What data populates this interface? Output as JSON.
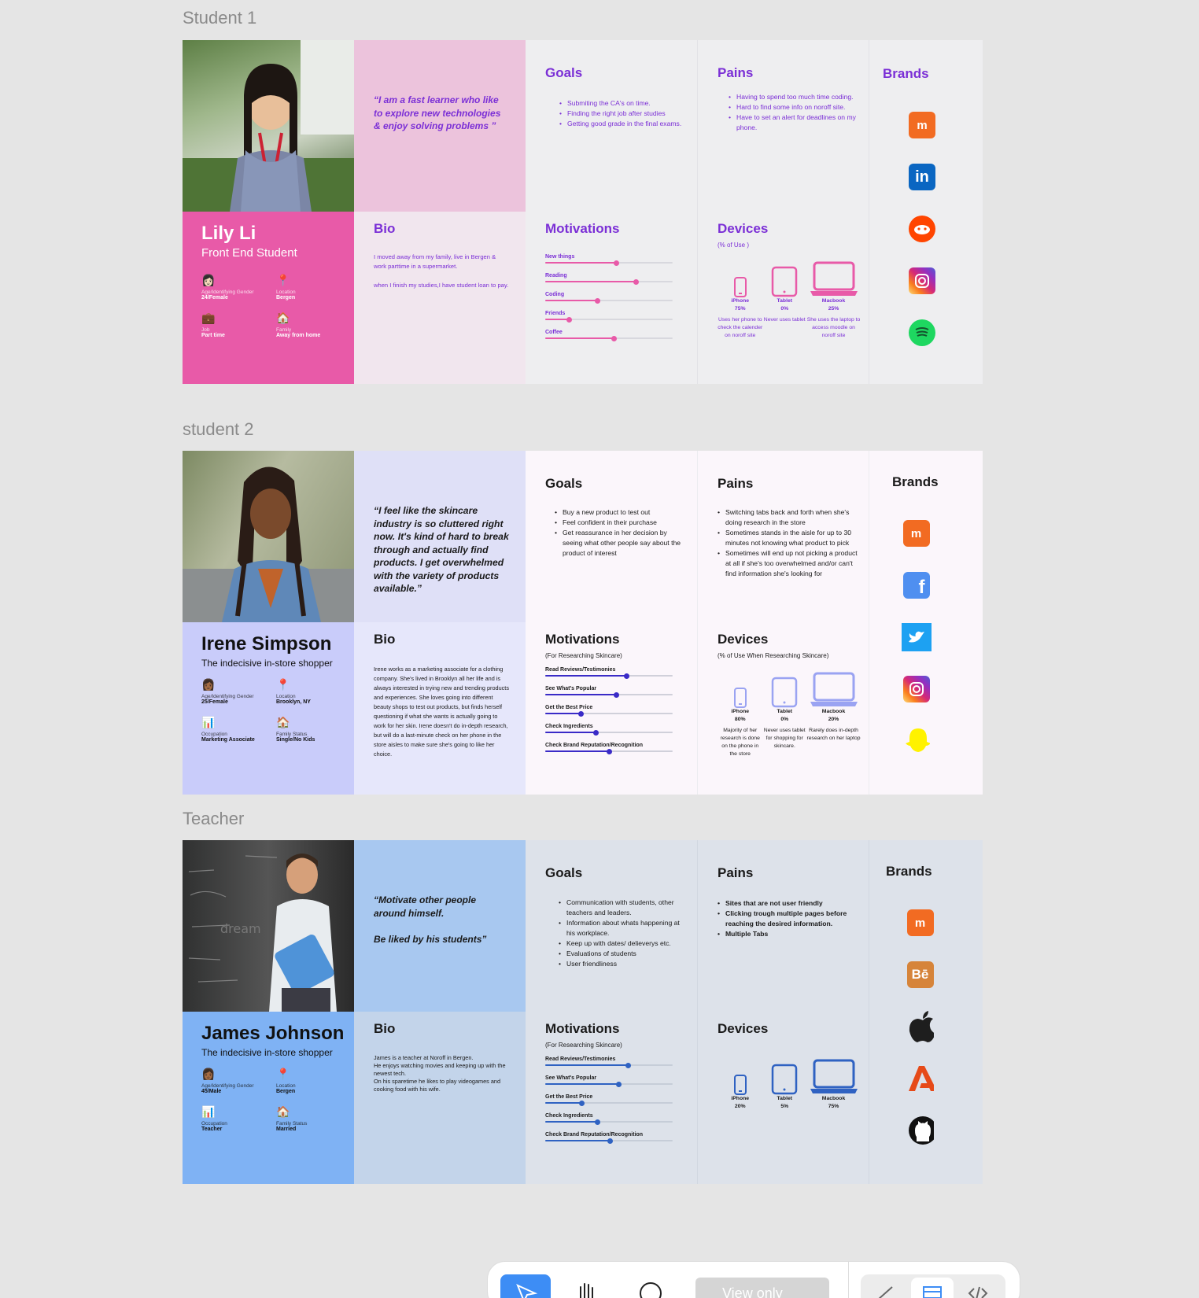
{
  "frames": {
    "student1": "Student 1",
    "student2": "student 2",
    "teacher": "Teacher"
  },
  "p1": {
    "quote": "“I am a fast learner who like to explore new technologies & enjoy solving problems ”",
    "goals_title": "Goals",
    "goals": [
      "Submiting the CA's on time.",
      "Finding the right job after studies",
      "Getting good grade in the final exams."
    ],
    "pains_title": "Pains",
    "pains": [
      "Having to spend too much time coding.",
      "Hard to find some info on noroff site.",
      "Have to set an alert for deadlines on my phone."
    ],
    "name": "Lily Li",
    "role": "Front End Student",
    "facts": [
      {
        "icon": "👩🏻",
        "label": "Age/Identifying Gender",
        "value": "24/Female"
      },
      {
        "icon": "📍",
        "label": "Location",
        "value": "Bergen"
      },
      {
        "icon": "💼",
        "label": "Job",
        "value": "Part time"
      },
      {
        "icon": "🏠",
        "label": "Family",
        "value": "Away from home"
      }
    ],
    "bio_title": "Bio",
    "bio": "I moved away from my family, live in Bergen & work parttime in a supermarket.\n\nwhen I finish my studies,I have student loan to pay.",
    "motivations_title": "Motivations",
    "motivations_sub": "",
    "motivations": [
      {
        "label": "New things",
        "value": 0.56
      },
      {
        "label": "Reading",
        "value": 0.71
      },
      {
        "label": "Coding",
        "value": 0.41
      },
      {
        "label": "Friends",
        "value": 0.19
      },
      {
        "label": "Coffee",
        "value": 0.54
      }
    ],
    "devices_title": "Devices",
    "devices_sub": "(% of Use )",
    "devices": [
      {
        "name": "iPhone",
        "pct": "75%",
        "note": "Uses her phone to check the calender on noroff site"
      },
      {
        "name": "Tablet",
        "pct": "0%",
        "note": "Never uses tablet"
      },
      {
        "name": "Macbook",
        "pct": "25%",
        "note": "She uses the laptop to access moodle on noroff site"
      }
    ],
    "brands_title": "Brands",
    "brands": [
      "moodle-icon",
      "linkedin-icon",
      "reddit-icon",
      "instagram-icon",
      "spotify-icon"
    ]
  },
  "p2": {
    "quote": "“I feel like the skincare industry is so cluttered right now. It's kind of hard to break through and actually find products. I get overwhelmed with the variety of products available.”",
    "goals_title": "Goals",
    "goals": [
      "Buy a new product to test out",
      "Feel confident in their purchase",
      "Get reassurance in her decision by seeing what other people say about the product of interest"
    ],
    "pains_title": "Pains",
    "pains": [
      "Switching tabs back and forth when she's doing research in the store",
      "Sometimes stands in the aisle for up to 30 minutes not knowing what product to pick",
      "Sometimes will end up not picking a product at all if she's too overwhelmed and/or can't find information she's looking for"
    ],
    "name": "Irene Simpson",
    "role": "The indecisive in-store shopper",
    "facts": [
      {
        "icon": "👩🏾",
        "label": "Age/Identifying Gender",
        "value": "25/Female"
      },
      {
        "icon": "📍",
        "label": "Location",
        "value": "Brooklyn, NY"
      },
      {
        "icon": "📊",
        "label": "Occupation",
        "value": "Marketing Associate"
      },
      {
        "icon": "🏠",
        "label": "Family Status",
        "value": "Single/No Kids"
      }
    ],
    "bio_title": "Bio",
    "bio": "Irene works as a marketing associate for a clothing company. She's lived in Brooklyn all her life and is always interested in trying new and trending products and experiences. She loves going into different beauty shops to test out products, but finds herself questioning if what she wants is actually going to work for her skin. Irene doesn't do in-depth research, but will do a last-minute check on her phone in the store aisles to make sure she's going to like her choice.",
    "motivations_title": "Motivations",
    "motivations_sub": "(For Researching Skincare)",
    "motivations": [
      {
        "label": "Read Reviews/Testimonies",
        "value": 0.64
      },
      {
        "label": "See What's Popular",
        "value": 0.56
      },
      {
        "label": "Get the Best Price",
        "value": 0.28
      },
      {
        "label": "Check Ingredients",
        "value": 0.4
      },
      {
        "label": "Check Brand Reputation/Recognition",
        "value": 0.5
      }
    ],
    "devices_title": "Devices",
    "devices_sub": "(% of Use When Researching Skincare)",
    "devices": [
      {
        "name": "iPhone",
        "pct": "80%",
        "note": "Majority of her research is done on the phone in the store"
      },
      {
        "name": "Tablet",
        "pct": "0%",
        "note": "Never uses tablet for shopping for skincare."
      },
      {
        "name": "Macbook",
        "pct": "20%",
        "note": "Rarely does in-depth research on her laptop"
      }
    ],
    "brands_title": "Brands",
    "brands": [
      "moodle-icon",
      "facebook-icon",
      "twitter-icon",
      "instagram-icon",
      "snapchat-icon"
    ]
  },
  "p3": {
    "quote": "“Motivate other people around himself.\n\nBe liked by his students”",
    "goals_title": "Goals",
    "goals": [
      "Communication with students, other teachers and leaders.",
      "Information about whats happening at his workplace.",
      "Keep up with dates/ delieverys etc.",
      "Evaluations of students",
      "User friendliness"
    ],
    "pains_title": "Pains",
    "pains": [
      "Sites that are not user friendly",
      "Clicking trough multiple pages before reaching the desired information.",
      "Multiple Tabs"
    ],
    "name": "James Johnson",
    "role": "The indecisive in-store shopper",
    "facts": [
      {
        "icon": "👩🏾",
        "label": "Age/Identifying Gender",
        "value": "45/Male"
      },
      {
        "icon": "📍",
        "label": "Location",
        "value": "Bergen"
      },
      {
        "icon": "📊",
        "label": "Occupation",
        "value": "Teacher"
      },
      {
        "icon": "🏠",
        "label": "Family Status",
        "value": "Married"
      }
    ],
    "bio_title": "Bio",
    "bio": "James is a teacher at Noroff in Bergen.\nHe enjoys watching movies and keeping up with the newest tech.\nOn his sparetime he likes to play videogames and cooking food with his wife.",
    "motivations_title": "Motivations",
    "motivations_sub": "(For Researching Skincare)",
    "motivations": [
      {
        "label": "Read Reviews/Testimonies",
        "value": 0.65
      },
      {
        "label": "See What's Popular",
        "value": 0.58
      },
      {
        "label": "Get the Best Price",
        "value": 0.29
      },
      {
        "label": "Check Ingredients",
        "value": 0.41
      },
      {
        "label": "Check Brand Reputation/Recognition",
        "value": 0.51
      }
    ],
    "devices_title": "Devices",
    "devices_sub": "",
    "devices": [
      {
        "name": "iPhone",
        "pct": "20%",
        "note": ""
      },
      {
        "name": "Tablet",
        "pct": "5%",
        "note": ""
      },
      {
        "name": "Macbook",
        "pct": "75%",
        "note": ""
      }
    ],
    "brands_title": "Brands",
    "brands": [
      "moodle-icon",
      "behance-icon",
      "apple-icon",
      "adobe-icon",
      "github-icon"
    ]
  },
  "toolbar": {
    "view_only": "View only",
    "tools": [
      "pointer-icon",
      "hand-icon",
      "comment-icon",
      "pen-icon",
      "layout-icon",
      "code-icon"
    ]
  },
  "colors": {
    "p1_accent": "#7b2fd6",
    "p1_pink": "#e85aa8",
    "p2_accent": "#3a2bc7",
    "p3_accent": "#2f62c2"
  }
}
